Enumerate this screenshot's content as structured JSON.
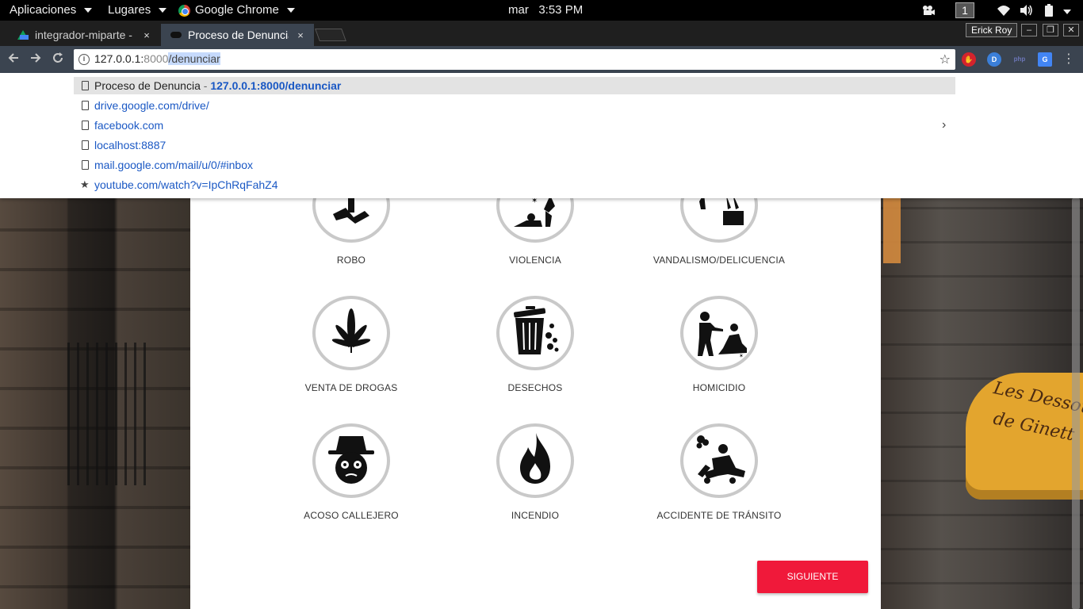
{
  "topbar": {
    "applications": "Aplicaciones",
    "places": "Lugares",
    "app_name": "Google Chrome",
    "clock": "mar   3:53 PM",
    "workspace": "1"
  },
  "tabs": [
    {
      "title": "integrador-miparte -",
      "close": "×"
    },
    {
      "title": "Proceso de Denuncia",
      "close": "×"
    }
  ],
  "window": {
    "profile": "Erick Roy"
  },
  "omnibox": {
    "url_host": "127.0.0.1:",
    "url_port": "8000",
    "url_path": "/denunciar"
  },
  "extensions": [
    {
      "name": "adblock-icon",
      "label": "✋",
      "color": "#d4232c"
    },
    {
      "name": "dashlane-icon",
      "label": "D",
      "color": "#3b7fd9"
    },
    {
      "name": "php-icon",
      "label": "php",
      "color": "#4f5b93"
    },
    {
      "name": "translate-icon",
      "label": "G",
      "color": "#4285f4"
    }
  ],
  "suggestions": [
    {
      "title": "Proceso de Denuncia",
      "sep": " - ",
      "url": "127.0.0.1:8000/denunciar",
      "icon": "page-icon"
    },
    {
      "url": "drive.google.com/drive/",
      "icon": "page-icon"
    },
    {
      "url": "facebook.com",
      "icon": "page-icon"
    },
    {
      "url": "localhost:8887",
      "icon": "page-icon"
    },
    {
      "url": "mail.google.com/mail/u/0/#inbox",
      "icon": "page-icon"
    },
    {
      "url": "youtube.com/watch?v=IpChRqFahZ4",
      "icon": "star-icon"
    }
  ],
  "background": {
    "sign_line1": "Les Dessou",
    "sign_line2": "de Ginett"
  },
  "categories": [
    {
      "label": "ROBO",
      "icon": "robbery-icon"
    },
    {
      "label": "VIOLENCIA",
      "icon": "violence-icon"
    },
    {
      "label": "VANDALISMO/DELICUENCIA",
      "icon": "vandalism-icon"
    },
    {
      "label": "VENTA DE DROGAS",
      "icon": "cannabis-leaf-icon"
    },
    {
      "label": "DESECHOS",
      "icon": "trash-can-icon"
    },
    {
      "label": "HOMICIDIO",
      "icon": "homicide-icon"
    },
    {
      "label": "ACOSO CALLEJERO",
      "icon": "harasser-face-icon"
    },
    {
      "label": "INCENDIO",
      "icon": "flame-icon"
    },
    {
      "label": "ACCIDENTE DE TRÁNSITO",
      "icon": "traffic-accident-icon"
    }
  ],
  "actions": {
    "next": "SIGUIENTE"
  }
}
